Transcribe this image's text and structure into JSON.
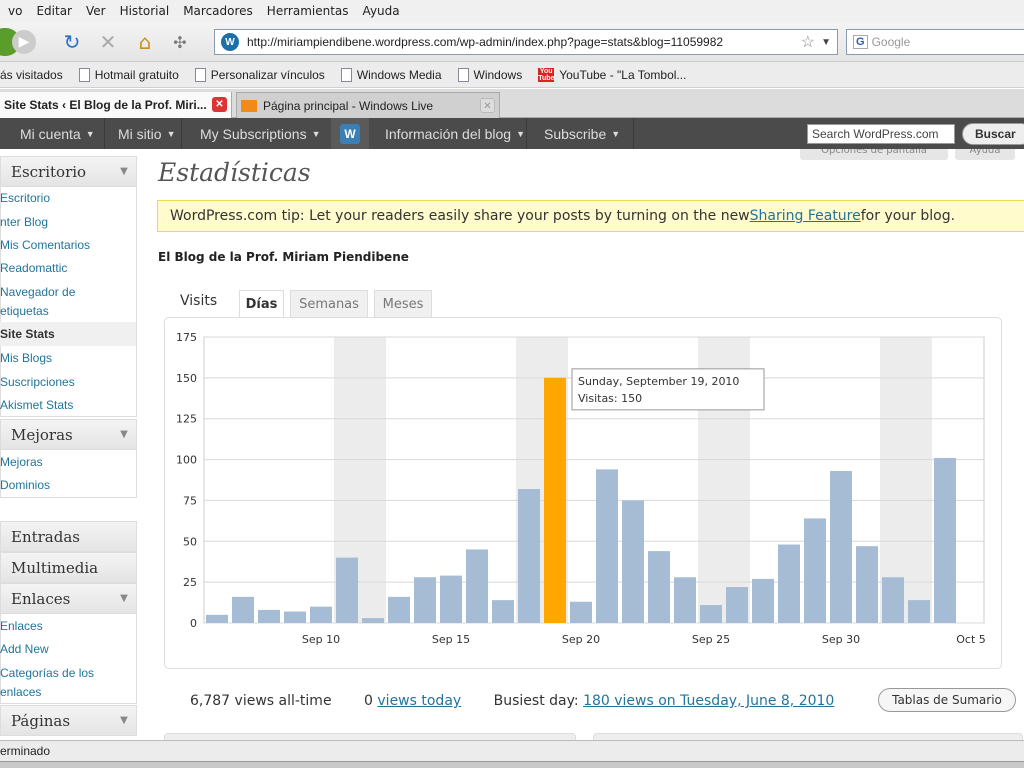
{
  "menu": [
    "vo",
    "Editar",
    "Ver",
    "Historial",
    "Marcadores",
    "Herramientas",
    "Ayuda"
  ],
  "url": "http://miriampiendibene.wordpress.com/wp-admin/index.php?page=stats&blog=11059982",
  "search_placeholder": "Google",
  "bookmarks": [
    "ás visitados",
    "Hotmail gratuito",
    "Personalizar vínculos",
    "Windows Media",
    "Windows",
    "YouTube - \"La Tombol..."
  ],
  "tabs": [
    {
      "label": "Site Stats ‹ El Blog de la Prof. Miri..."
    },
    {
      "label": "Página principal - Windows Live"
    }
  ],
  "adminbar": {
    "items": [
      "Mi cuenta",
      "Mi sitio",
      "My Subscriptions",
      "Información del blog",
      "Subscribe"
    ],
    "search_placeholder": "Search WordPress.com",
    "search_button": "Buscar"
  },
  "screen_options": "Opciones de pantalla",
  "help": "Ayuda",
  "sidebar": {
    "escritorio_head": "Escritorio",
    "escritorio_items": [
      "Escritorio",
      "nter Blog",
      "Mis Comentarios",
      "Readomattic",
      "Navegador de",
      "etiquetas",
      "Site Stats",
      "Mis Blogs",
      "Suscripciones",
      "Akismet Stats"
    ],
    "mejoras_head": "Mejoras",
    "mejoras_items": [
      "Mejoras",
      "Dominios"
    ],
    "entradas_head": "Entradas",
    "multimedia_head": "Multimedia",
    "enlaces_head": "Enlaces",
    "enlaces_items": [
      "Enlaces",
      "Add New",
      "Categorías de los",
      "enlaces"
    ],
    "paginas_head": "Páginas"
  },
  "page_title": "Estadísticas",
  "tip": {
    "prefix": "WordPress.com tip: Let your readers easily share your posts by turning on the new ",
    "link": "Sharing Feature",
    "suffix": " for your blog."
  },
  "blog_name": "El Blog de la Prof. Miriam Piendibene",
  "chart_tabs": {
    "label": "Visits",
    "tabs": [
      "Días",
      "Semanas",
      "Meses"
    ],
    "active": "Días"
  },
  "tooltip": {
    "title": "Sunday, September 19, 2010",
    "line": "Visitas: 150"
  },
  "summary": {
    "alltime": "6,787 views all-time",
    "today_num": "0",
    "today_link": "views today",
    "busiest_label": "Busiest day:",
    "busiest_link": "180 views on Tuesday, June 8, 2010",
    "button": "Tablas de Sumario"
  },
  "status": "erminado",
  "colors": {
    "bar": "#a5bcd4",
    "highlight": "#ffa600",
    "adminbar": "#4b4b4b",
    "link": "#21759b",
    "weekend_band": "#ececec"
  },
  "chart_data": {
    "type": "bar",
    "title": "",
    "xlabel": "",
    "ylabel": "",
    "ylim": [
      0,
      175
    ],
    "yticks": [
      0,
      25,
      50,
      75,
      100,
      125,
      150,
      175
    ],
    "categories": [
      "Sep 6",
      "Sep 7",
      "Sep 8",
      "Sep 9",
      "Sep 10",
      "Sep 11",
      "Sep 12",
      "Sep 13",
      "Sep 14",
      "Sep 15",
      "Sep 16",
      "Sep 17",
      "Sep 18",
      "Sep 19",
      "Sep 20",
      "Sep 21",
      "Sep 22",
      "Sep 23",
      "Sep 24",
      "Sep 25",
      "Sep 26",
      "Sep 27",
      "Sep 28",
      "Sep 29",
      "Sep 30",
      "Oct 1",
      "Oct 2",
      "Oct 3",
      "Oct 4",
      "Oct 5"
    ],
    "values": [
      5,
      16,
      8,
      7,
      10,
      40,
      3,
      16,
      28,
      29,
      45,
      14,
      82,
      150,
      13,
      94,
      75,
      44,
      28,
      11,
      22,
      27,
      48,
      64,
      93,
      47,
      28,
      14,
      101,
      0
    ],
    "x_tick_labels": [
      "Sep 10",
      "Sep 15",
      "Sep 20",
      "Sep 25",
      "Sep 30",
      "Oct 5"
    ],
    "x_tick_indices": [
      4,
      9,
      14,
      19,
      24,
      29
    ],
    "weekend_indices": [
      5,
      6,
      12,
      13,
      19,
      20,
      26,
      27
    ],
    "highlight_index": 13,
    "grid": true
  }
}
